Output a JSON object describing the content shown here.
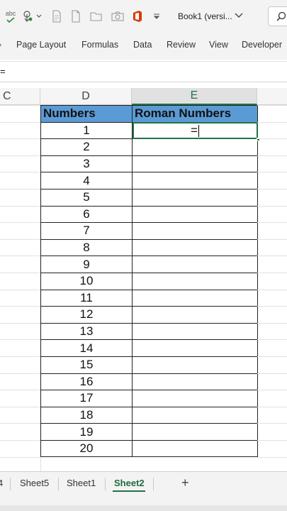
{
  "toolbar": {
    "doc_title": "Book1 (versi...",
    "icons": [
      "spelling-icon",
      "touch-mode-icon",
      "chevron-down-icon",
      "print-preview-icon",
      "new-file-icon",
      "open-file-icon",
      "camera-icon",
      "office-icon",
      "customize-qat-icon",
      "chevron-down-icon",
      "search-icon"
    ],
    "spelling_label": "abc"
  },
  "ribbon": {
    "tabs": [
      "Page Layout",
      "Formulas",
      "Data",
      "Review",
      "View",
      "Developer"
    ]
  },
  "formula_bar": {
    "content": "="
  },
  "grid": {
    "columns": [
      "C",
      "D",
      "E"
    ],
    "selected_column": "E",
    "table": {
      "headers": [
        "Numbers",
        "Roman Numbers"
      ],
      "numbers": [
        "1",
        "2",
        "3",
        "4",
        "5",
        "6",
        "7",
        "8",
        "9",
        "10",
        "11",
        "12",
        "13",
        "14",
        "15",
        "16",
        "17",
        "18",
        "19",
        "20"
      ],
      "active_cell_value": "="
    }
  },
  "sheets": {
    "tabs": [
      "4",
      "Sheet5",
      "Sheet1",
      "Sheet2"
    ],
    "active": "Sheet2",
    "add_label": "+"
  },
  "colors": {
    "accent": "#217346",
    "header_fill": "#5b9bd5"
  }
}
